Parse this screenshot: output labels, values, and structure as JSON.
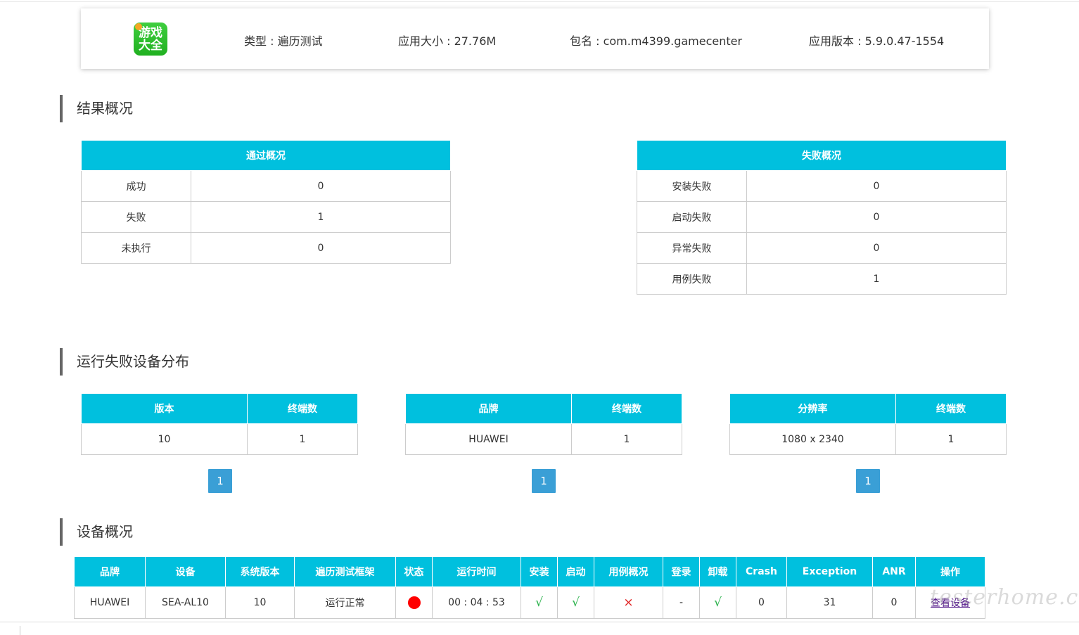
{
  "header": {
    "logo_text_line1": "游戏",
    "logo_text_line2": "大全",
    "type": "类型 : 遍历测试",
    "size": "应用大小 : 27.76M",
    "package": "包名 : com.m4399.gamecenter",
    "version": "应用版本 : 5.9.0.47-1554"
  },
  "sections": {
    "result_overview": "结果概况",
    "failure_distribution": "运行失败设备分布",
    "device_overview": "设备概况"
  },
  "pass_table": {
    "header": "通过概况",
    "rows": [
      {
        "label": "成功",
        "value": "0"
      },
      {
        "label": "失败",
        "value": "1"
      },
      {
        "label": "未执行",
        "value": "0"
      }
    ]
  },
  "fail_table": {
    "header": "失败概况",
    "rows": [
      {
        "label": "安装失败",
        "value": "0"
      },
      {
        "label": "启动失败",
        "value": "0"
      },
      {
        "label": "异常失败",
        "value": "0"
      },
      {
        "label": "用例失败",
        "value": "1"
      }
    ]
  },
  "dist_version": {
    "col1": "版本",
    "col2": "终端数",
    "rows": [
      {
        "a": "10",
        "b": "1"
      }
    ],
    "page": "1"
  },
  "dist_brand": {
    "col1": "品牌",
    "col2": "终端数",
    "rows": [
      {
        "a": "HUAWEI",
        "b": "1"
      }
    ],
    "page": "1"
  },
  "dist_resolution": {
    "col1": "分辨率",
    "col2": "终端数",
    "rows": [
      {
        "a": "1080 x 2340",
        "b": "1"
      }
    ],
    "page": "1"
  },
  "device_table": {
    "headers": [
      "品牌",
      "设备",
      "系统版本",
      "遍历测试框架",
      "状态",
      "运行时间",
      "安装",
      "启动",
      "用例概况",
      "登录",
      "卸载",
      "Crash",
      "Exception",
      "ANR",
      "操作"
    ],
    "row": {
      "brand": "HUAWEI",
      "device": "SEA-AL10",
      "os": "10",
      "framework": "运行正常",
      "status_color": "#ff0000",
      "runtime": "00 : 04 : 53",
      "install": "√",
      "launch": "√",
      "case": "×",
      "login": "-",
      "uninstall": "√",
      "crash": "0",
      "exception": "31",
      "anr": "0",
      "action": "查看设备"
    }
  },
  "watermark": "testerhome.com",
  "colors": {
    "header_bg": "#00c0de",
    "pager_bg": "#3a9fd6",
    "check": "#2bb24c",
    "cross": "#e02020"
  }
}
